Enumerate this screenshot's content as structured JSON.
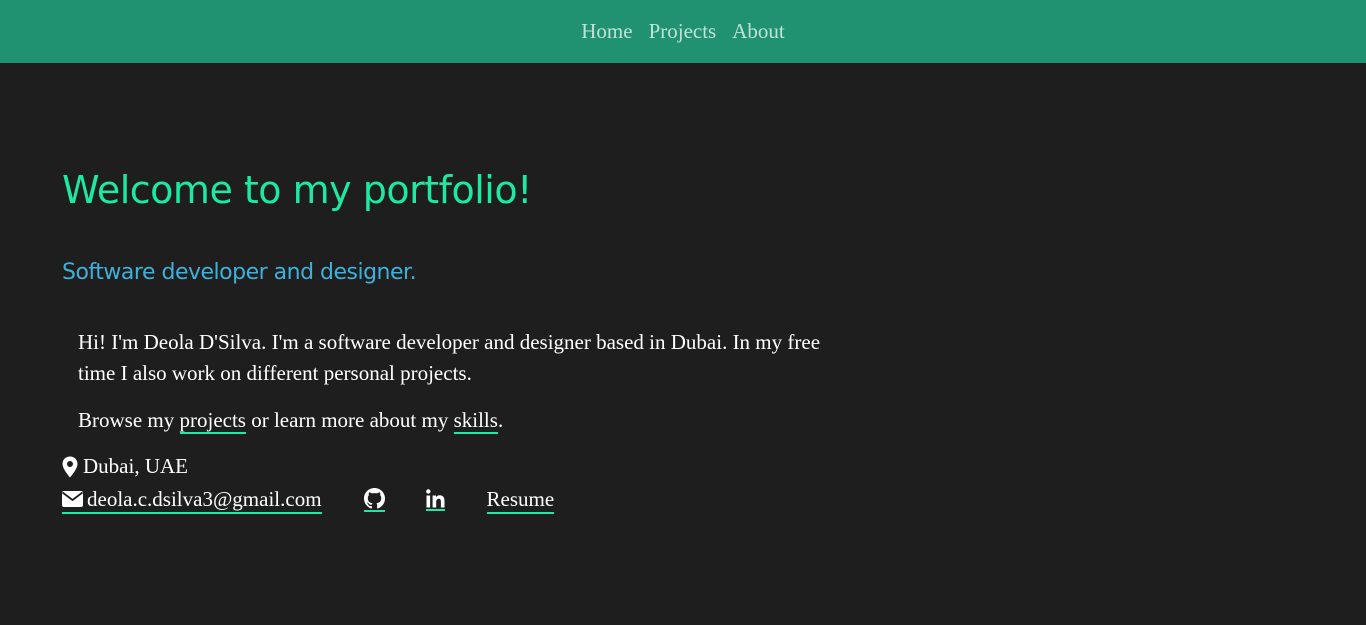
{
  "nav": {
    "items": [
      {
        "label": "Home"
      },
      {
        "label": "Projects"
      },
      {
        "label": "About"
      }
    ]
  },
  "hero": {
    "title": "Welcome to my portfolio!",
    "subtitle": "Software developer and designer."
  },
  "intro": {
    "text": "Hi! I'm Deola D'Silva. I'm a software developer and designer based in Dubai. In my free time I also work on different personal projects."
  },
  "browse": {
    "prefix": "Browse my ",
    "projects_link": "projects",
    "middle": " or learn more about my ",
    "skills_link": "skills",
    "suffix": "."
  },
  "contact": {
    "location": "Dubai, UAE",
    "email": "deola.c.dsilva3@gmail.com",
    "resume_label": "Resume"
  },
  "icons": {
    "location": "map-marker-icon",
    "email": "envelope-icon",
    "github": "github-icon",
    "linkedin": "linkedin-icon"
  },
  "colors": {
    "navbar_bg": "#209171",
    "nav_text": "#bfe3d6",
    "page_bg": "#1e1e1e",
    "title": "#1de9a1",
    "subtitle": "#3fb0dc",
    "link_underline": "#1de9a1"
  }
}
